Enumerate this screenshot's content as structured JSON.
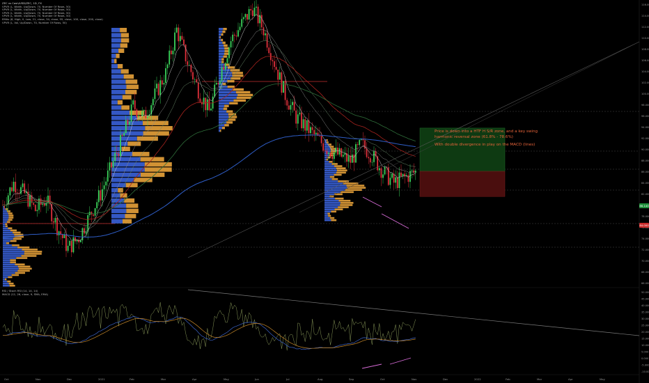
{
  "header": {
    "symbol_line": "ZEC vs Cash/USD/ZEC, 1D, FX",
    "indicators": [
      "VPVR (L, Width, Up/Down, 70, Number Of Rows, 50)",
      "VPVR (L, Width, Up/Down, 70, Number Of Rows, 50)",
      "VPVR (L, Width, Up/Down, 70, Number Of Rows, 50)",
      "VPVR (L, Width, Up/Down, 70, Number Of Rows, 50)",
      "EMAs (8, High, 0, Low, 21, close, 34, close, 55, close, 100, close, 200, close)",
      "VPVR (L, Vol, Up/Down, 70, Number Of Rows, 50)"
    ],
    "osc_indicators": [
      "RSI / Stoch RSI (14, 14, 14)",
      "MACD (12, 26, close, 9, SMA, EMA)"
    ]
  },
  "annotation": {
    "line1": "Price is down into a HTF H S/R zone, and a key swing harmonic reversal zone (61.8% - 78.6%)",
    "line2": "With double divergence in play on the MACD (lines)"
  },
  "price_axis": {
    "ticks": [
      "116.000",
      "114.000",
      "112.000",
      "110.000",
      "108.000",
      "106.000",
      "104.000",
      "102.000",
      "100.000",
      "98.000",
      "96.000",
      "94.000",
      "92.000",
      "90.000",
      "88.000",
      "86.000",
      "84.000",
      "82.000",
      "80.000",
      "78.000",
      "76.000",
      "74.000",
      "72.000",
      "70.000",
      "68.000",
      "66.000"
    ],
    "current_price": "86.140",
    "label_green": "86.140",
    "label_red": "84.000"
  },
  "osc_axis": {
    "ticks": [
      "50.000",
      "45.000",
      "40.000",
      "35.000",
      "30.000",
      "25.000",
      "20.000",
      "15.000",
      "10.000",
      "5.000",
      "0.000",
      "-5.000",
      "-10.000"
    ]
  },
  "time_axis": {
    "ticks": [
      "Oct",
      "Nov",
      "Dec",
      "2021",
      "Feb",
      "Mar",
      "Apr",
      "May",
      "Jun",
      "Jul",
      "Aug",
      "Sep",
      "Oct",
      "Nov",
      "Dec",
      "2022",
      "Feb",
      "Mar",
      "Apr",
      "May"
    ]
  },
  "colors": {
    "up_candle": "#3bd35a",
    "down_candle": "#e0303b",
    "volume_profile_up": "#e8a23a",
    "volume_profile_down": "#3a62d9",
    "target_box": "#0e3a12",
    "stop_box": "#4a0e0e",
    "annotation_text": "#e8643a",
    "divergence_line": "#d86cd8",
    "ema_blue": "#2f5ec8",
    "ema_red": "#a8231e",
    "ema_green": "#2f6e3a"
  },
  "chart_data": {
    "type": "candlestick",
    "title": "",
    "series": [
      {
        "points": [
          [
            0,
            80
          ],
          [
            6,
            84
          ],
          [
            12,
            82
          ],
          [
            18,
            79
          ],
          [
            24,
            81
          ],
          [
            30,
            76
          ],
          [
            36,
            72
          ],
          [
            42,
            74
          ],
          [
            48,
            78
          ],
          [
            54,
            82
          ],
          [
            60,
            87
          ],
          [
            66,
            92
          ],
          [
            72,
            98
          ],
          [
            78,
            96
          ],
          [
            84,
            100
          ],
          [
            90,
            104
          ],
          [
            96,
            112
          ],
          [
            102,
            106
          ],
          [
            108,
            101
          ],
          [
            114,
            97
          ],
          [
            120,
            104
          ],
          [
            126,
            110
          ],
          [
            132,
            113
          ],
          [
            138,
            116
          ],
          [
            144,
            112
          ],
          [
            150,
            106
          ],
          [
            156,
            100
          ],
          [
            162,
            96
          ],
          [
            168,
            94
          ],
          [
            174,
            92
          ],
          [
            180,
            90
          ],
          [
            186,
            89
          ],
          [
            192,
            88
          ],
          [
            198,
            91
          ],
          [
            204,
            89
          ],
          [
            210,
            86
          ],
          [
            216,
            84
          ],
          [
            222,
            85
          ],
          [
            228,
            86
          ]
        ]
      }
    ],
    "target_zone": [
      86.1,
      94.0
    ],
    "stop_zone": [
      81.5,
      86.1
    ]
  }
}
